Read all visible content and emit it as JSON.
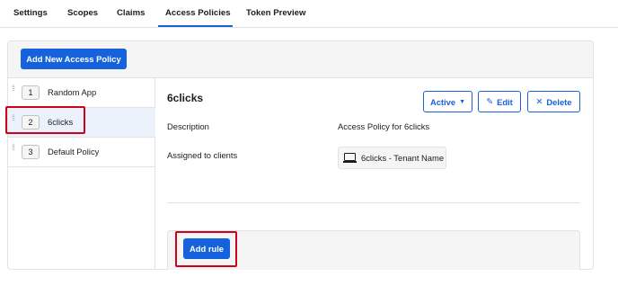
{
  "tabs": [
    {
      "label": "Settings"
    },
    {
      "label": "Scopes"
    },
    {
      "label": "Claims"
    },
    {
      "label": "Access Policies"
    },
    {
      "label": "Token Preview"
    }
  ],
  "active_tab": "Access Policies",
  "toolbar": {
    "add_policy_label": "Add New Access Policy"
  },
  "policies": [
    {
      "number": "1",
      "name": "Random App"
    },
    {
      "number": "2",
      "name": "6clicks"
    },
    {
      "number": "3",
      "name": "Default Policy"
    }
  ],
  "selected_policy": "6clicks",
  "detail": {
    "title": "6clicks",
    "status_button": "Active",
    "edit_label": "Edit",
    "delete_label": "Delete",
    "description_label": "Description",
    "description_value": "Access Policy for 6clicks",
    "assigned_label": "Assigned to clients",
    "client_name": "6clicks - Tenant Name",
    "add_rule_label": "Add rule"
  },
  "colors": {
    "accent": "#1662dd",
    "highlight": "#d0021b",
    "selected_row": "#ebf2fc"
  },
  "icons": [
    "drag-handle-icon",
    "caret-down-icon",
    "pencil-icon",
    "close-icon",
    "laptop-icon"
  ]
}
